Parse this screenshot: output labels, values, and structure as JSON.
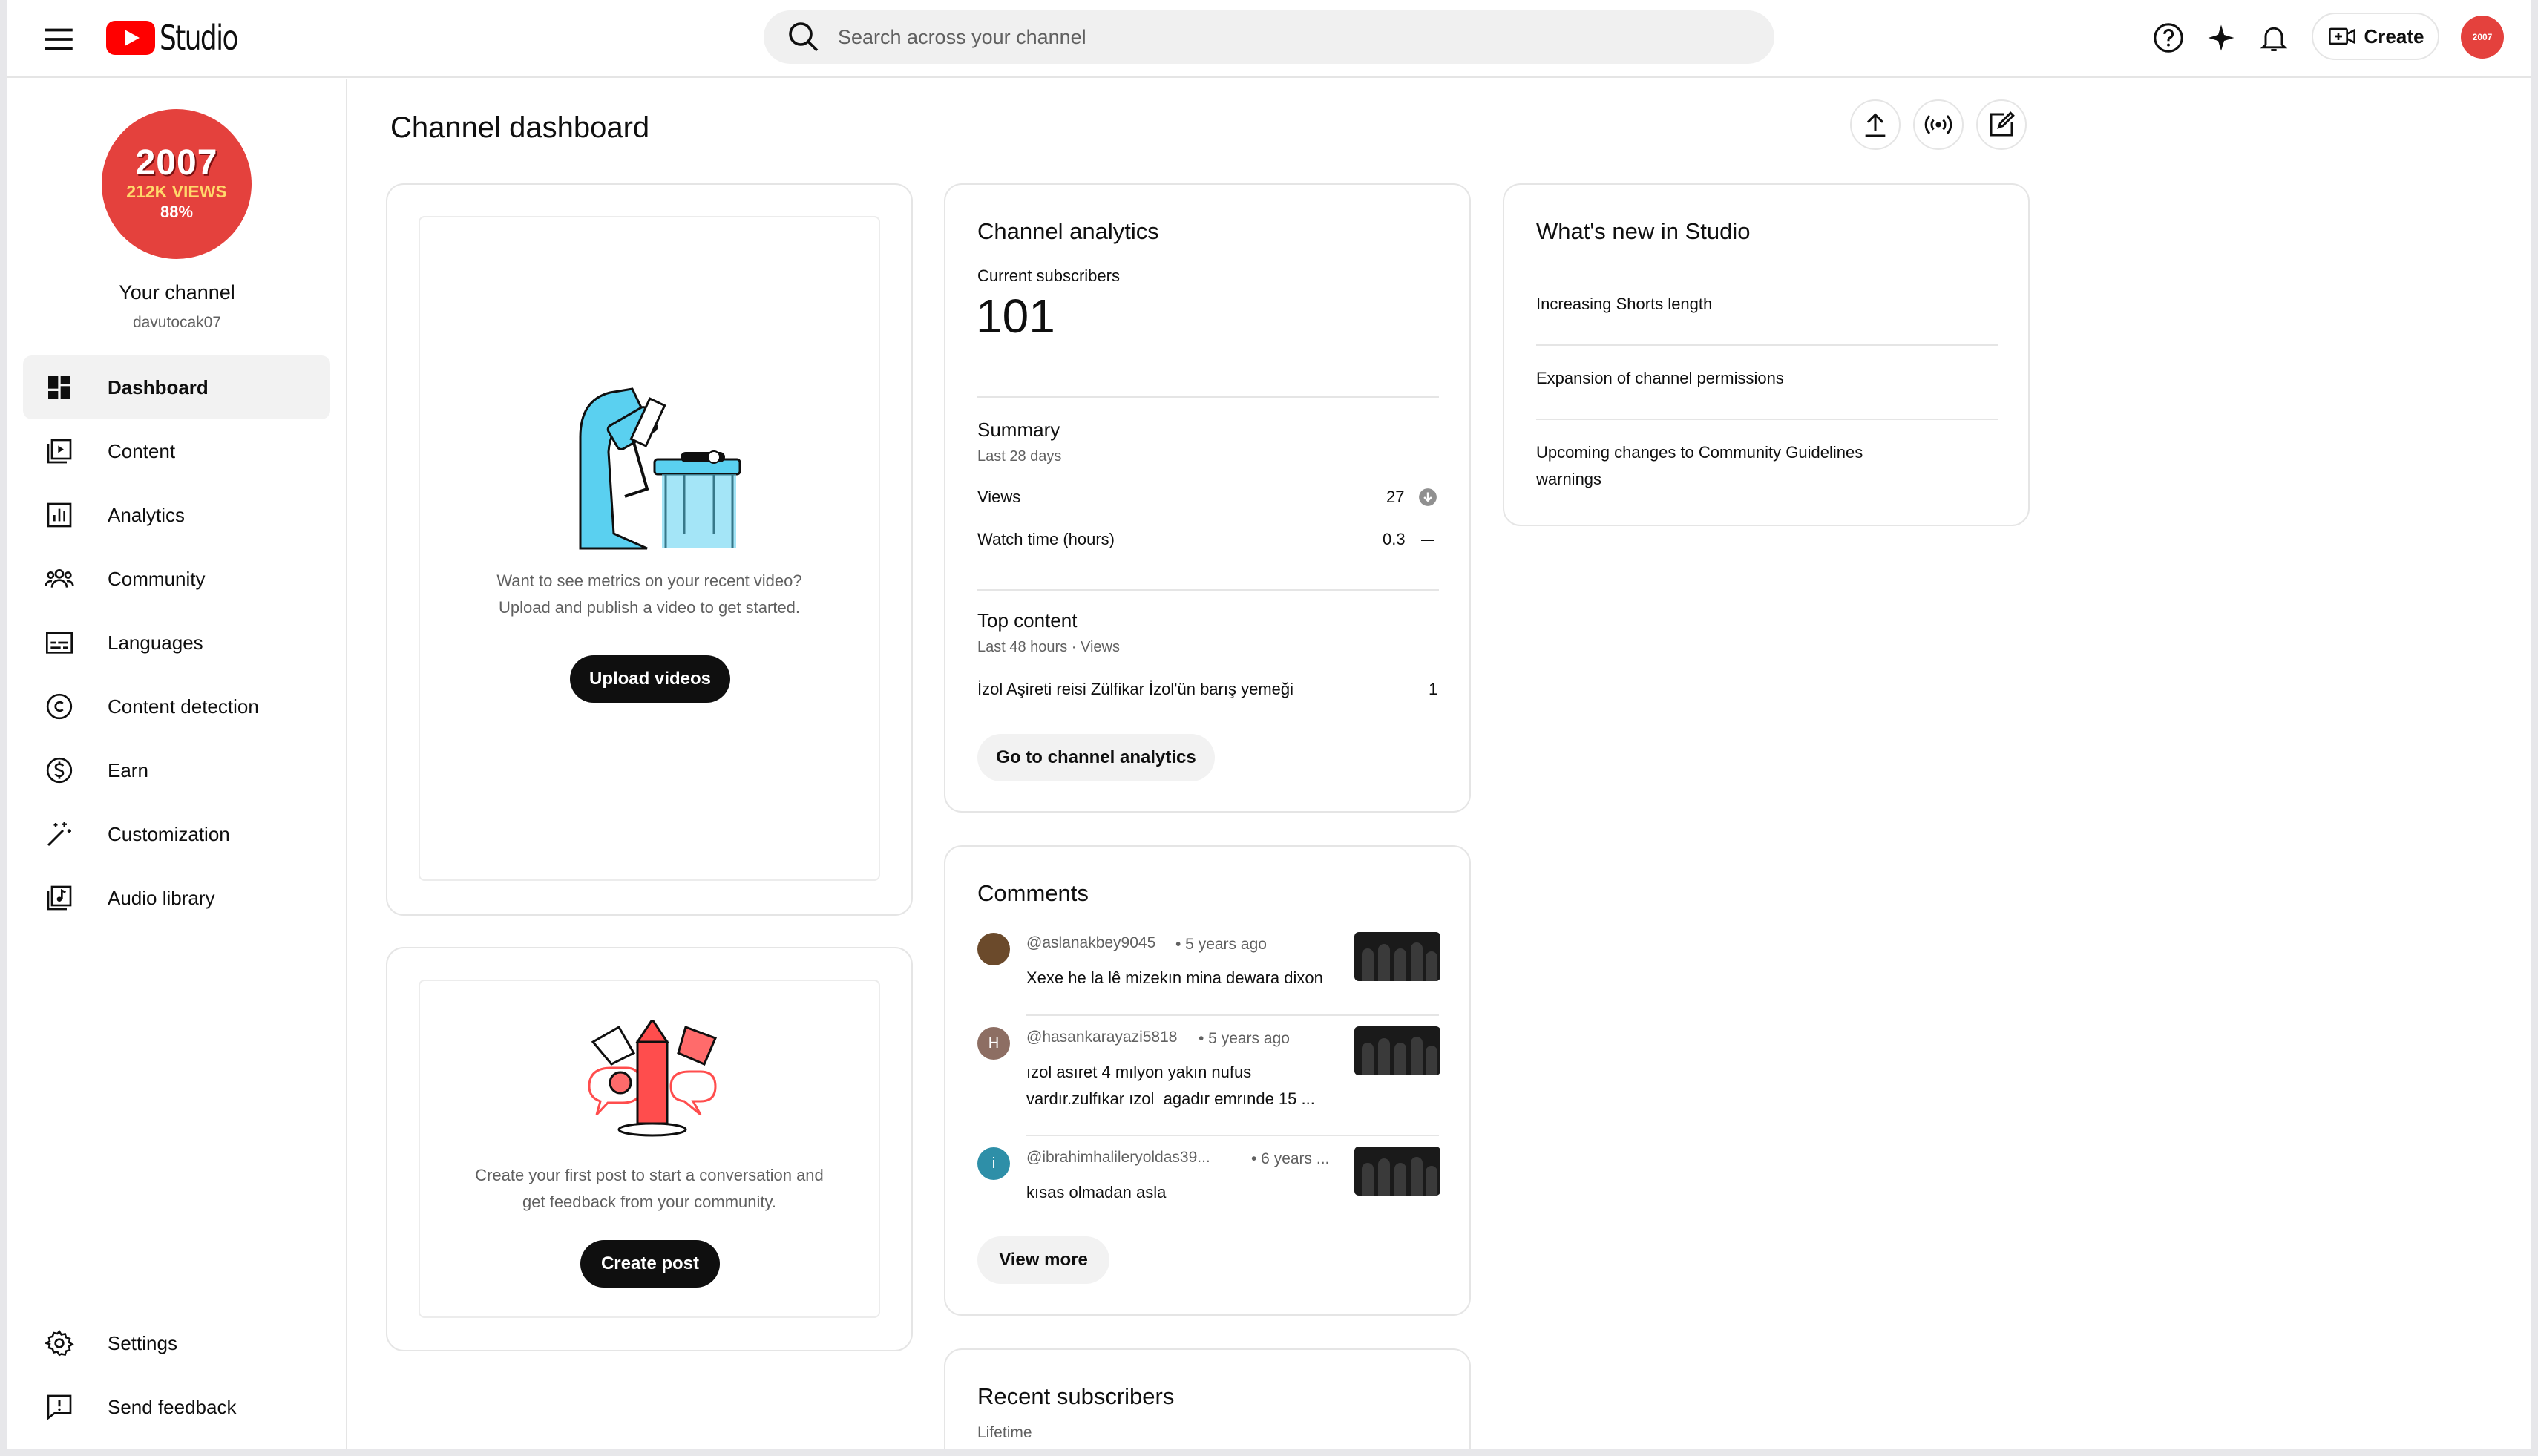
{
  "header": {
    "logo_text": "Studio",
    "search_placeholder": "Search across your channel",
    "create_label": "Create",
    "avatar_text": "2007"
  },
  "sidebar": {
    "avatar": {
      "line1": "2007",
      "line2": "212K VIEWS",
      "line3": "88%"
    },
    "channel_label": "Your channel",
    "handle": "davutocak07",
    "items": [
      {
        "label": "Dashboard",
        "icon": "dashboard-icon",
        "active": true
      },
      {
        "label": "Content",
        "icon": "content-icon"
      },
      {
        "label": "Analytics",
        "icon": "analytics-icon"
      },
      {
        "label": "Community",
        "icon": "community-icon"
      },
      {
        "label": "Languages",
        "icon": "languages-icon"
      },
      {
        "label": "Content detection",
        "icon": "copyright-icon"
      },
      {
        "label": "Earn",
        "icon": "dollar-icon"
      },
      {
        "label": "Customization",
        "icon": "magic-wand-icon"
      },
      {
        "label": "Audio library",
        "icon": "audio-library-icon"
      }
    ],
    "bottom_items": [
      {
        "label": "Settings",
        "icon": "gear-icon"
      },
      {
        "label": "Send feedback",
        "icon": "feedback-icon"
      }
    ]
  },
  "main": {
    "title": "Channel dashboard",
    "upload_card": {
      "text_line1": "Want to see metrics on your recent video?",
      "text_line2": "Upload and publish a video to get started.",
      "button": "Upload videos"
    },
    "post_card": {
      "text_line1": "Create your first post to start a conversation and",
      "text_line2": "get feedback from your community.",
      "button": "Create post"
    },
    "analytics": {
      "title": "Channel analytics",
      "subs_label": "Current subscribers",
      "subs_value": "101",
      "summary_title": "Summary",
      "summary_period": "Last 28 days",
      "rows": [
        {
          "label": "Views",
          "value": "27"
        },
        {
          "label": "Watch time (hours)",
          "value": "0.3"
        }
      ],
      "top_title": "Top content",
      "top_period": "Last 48 hours · Views",
      "top_item": "İzol Aşireti reisi Zülfikar İzol'ün barış yemeği",
      "top_value": "1",
      "button": "Go to channel analytics"
    },
    "comments": {
      "title": "Comments",
      "items": [
        {
          "user": "@aslanakbey9045",
          "time": "• 5 years ago",
          "text": "Xexe he la lê mizekın mina dewara dixon",
          "avatar": "",
          "avatar_color": "#6b4a2b"
        },
        {
          "user": "@hasankarayazi5818",
          "time": "• 5 years ago",
          "text": "ızol asıret 4 mılyon yakın nufus",
          "text2": "vardır.zulfıkar ızol  agadır emrınde 15 ...",
          "avatar": "H",
          "avatar_color": "#8d6e63"
        },
        {
          "user": "@ibrahimhalileryoldas39...",
          "time": "• 6 years ...",
          "text": "kısas olmadan asla",
          "avatar": "i",
          "avatar_color": "#2e8fa8"
        }
      ],
      "button": "View more"
    },
    "recent_subs": {
      "title": "Recent subscribers",
      "period": "Lifetime"
    },
    "whats_new": {
      "title": "What's new in Studio",
      "items": [
        "Increasing Shorts length",
        "Expansion of channel permissions",
        "Upcoming changes to Community Guidelines",
        "warnings"
      ]
    }
  }
}
